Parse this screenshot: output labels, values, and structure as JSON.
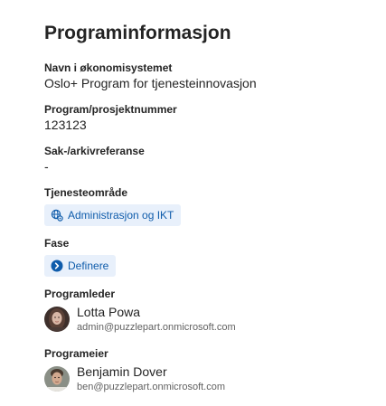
{
  "section": {
    "title": "Programinformasjon"
  },
  "fields": {
    "economy_name": {
      "label": "Navn i økonomisystemet",
      "value": "Oslo+ Program for tjenesteinnovasjon"
    },
    "project_number": {
      "label": "Program/prosjektnummer",
      "value": "123123"
    },
    "archive_ref": {
      "label": "Sak-/arkivreferanse",
      "value": "-"
    },
    "service_area": {
      "label": "Tjenesteområde",
      "tag": "Administrasjon og IKT",
      "icon": "globe-gear-icon"
    },
    "phase": {
      "label": "Fase",
      "tag": "Definere",
      "icon": "chevron-circle-icon"
    },
    "program_lead": {
      "label": "Programleder",
      "name": "Lotta Powa",
      "email": "admin@puzzlepart.onmicrosoft.com"
    },
    "program_owner": {
      "label": "Programeier",
      "name": "Benjamin Dover",
      "email": "ben@puzzlepart.onmicrosoft.com"
    }
  },
  "colors": {
    "tag_background": "#e8f0fb",
    "tag_text": "#0f5cab",
    "accent": "#0f6cbd"
  }
}
